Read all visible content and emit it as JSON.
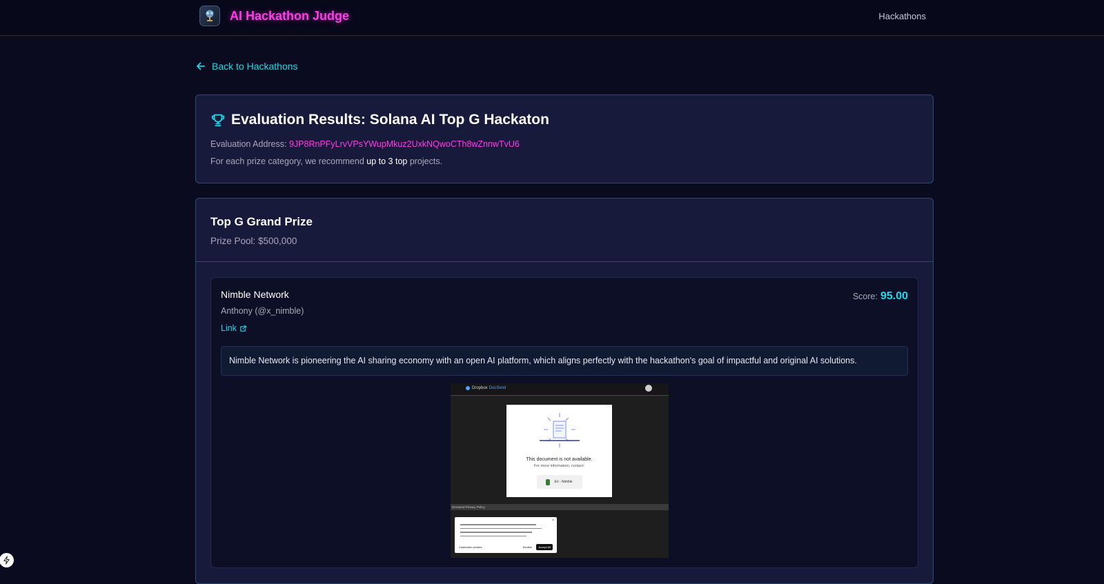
{
  "header": {
    "app_title": "AI Hackathon Judge",
    "nav_hackathons": "Hackathons",
    "logo_icon": "tree-logo-icon"
  },
  "back_link": {
    "label": "Back to Hackathons",
    "icon": "arrow-left-icon"
  },
  "summary": {
    "icon": "trophy-icon",
    "title": "Evaluation Results: Solana AI Top G Hackaton",
    "address_label": "Evaluation Address: ",
    "address": "9JP8RnPFyLrvVPsYWupMkuz2UxkNQwoCTh8wZnnwTvU6",
    "recommend_prefix": "For each prize category, we recommend ",
    "recommend_emphasis": "up to 3 top",
    "recommend_suffix": " projects."
  },
  "prize": {
    "title": "Top G Grand Prize",
    "pool": "Prize Pool: $500,000"
  },
  "project": {
    "name": "Nimble Network",
    "author": "Anthony (@x_nimble)",
    "link_label": "Link",
    "link_icon": "external-link-icon",
    "score_label": "Score:",
    "score_value": "95.00",
    "rationale": "Nimble Network is pioneering the AI sharing economy with an open AI platform, which aligns perfectly with the hackathon's goal of impactful and original AI solutions."
  },
  "screenshot": {
    "brand": "Dropbox",
    "brand_product": "DocSend",
    "doc_unavailable": "This document is not available.",
    "doc_more": "For more information, contact:",
    "contact_chip": "Eri - Nimble",
    "footer_strip": "DocSend Privacy Policy",
    "cookie_customize": "Customize cookies",
    "cookie_decline": "Decline",
    "cookie_accept": "Accept All"
  },
  "colors": {
    "background": "#0a0b1f",
    "brand_magenta": "#ff3ce8",
    "accent_cyan": "#1fd8e8",
    "card": "#171a3a",
    "card_border": "#2a4f73"
  }
}
